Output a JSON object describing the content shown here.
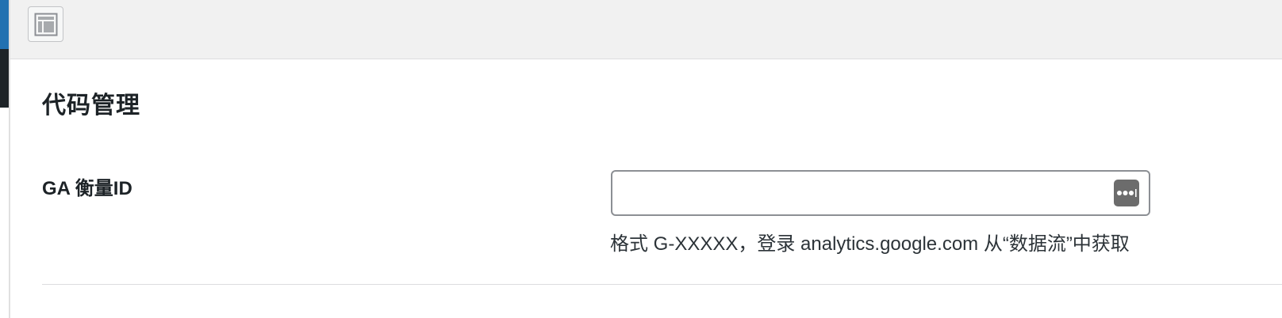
{
  "toolbar": {
    "layout_toggle_icon": "layout-panel-icon"
  },
  "section": {
    "title": "代码管理"
  },
  "field": {
    "label": "GA 衡量ID",
    "value": "",
    "placeholder": "",
    "autofill_icon": "password-manager-icon",
    "help": "格式 G-XXXXX，登录 analytics.google.com 从“数据流”中获取"
  },
  "colors": {
    "accent": "#2271b1",
    "sidebar_dark": "#1d2327",
    "toolbar_bg": "#f1f1f1",
    "input_border": "#8c8f94"
  }
}
